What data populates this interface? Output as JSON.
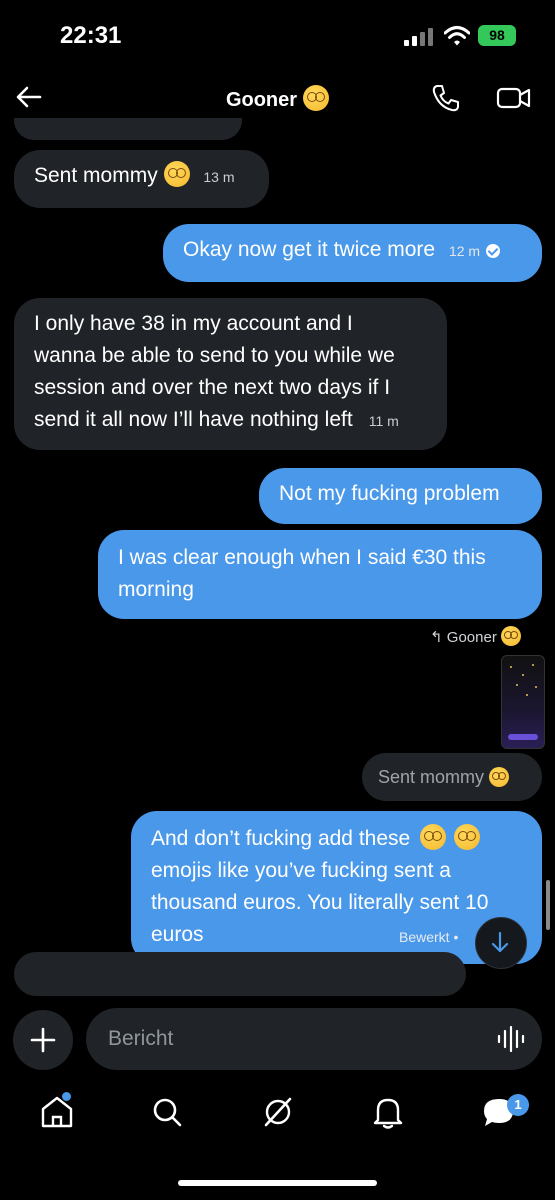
{
  "status": {
    "time": "22:31",
    "battery": "98"
  },
  "header": {
    "title": "Gooner"
  },
  "messages": {
    "m1": {
      "text": "Sent mommy",
      "time": "13 m"
    },
    "m2": {
      "text": "Okay now get it twice more",
      "time": "12 m"
    },
    "m3": {
      "lines": [
        "I only have 38 in my account and I",
        "wanna be able to send to you while we",
        "session and over the next two days if I",
        "send it all now I’ll have nothing left"
      ],
      "time": "11 m"
    },
    "m4": {
      "text": "Not my fucking problem"
    },
    "m5": {
      "lines": [
        "I was clear enough when I said €30 this",
        "morning"
      ]
    },
    "reply_ref": "Gooner",
    "m6": {
      "text": "Sent mommy"
    },
    "m7": {
      "lines": [
        "And don’t fucking add these",
        "emojis like you’ve fucking sent a",
        "thousand euros. You literally sent 10",
        "euros"
      ],
      "edited": "Bewerkt"
    }
  },
  "composer": {
    "placeholder": "Bericht"
  },
  "nav": {
    "messages_badge": "1"
  },
  "colors": {
    "accent": "#4a98e9",
    "incoming": "#202327",
    "background": "#000000"
  }
}
